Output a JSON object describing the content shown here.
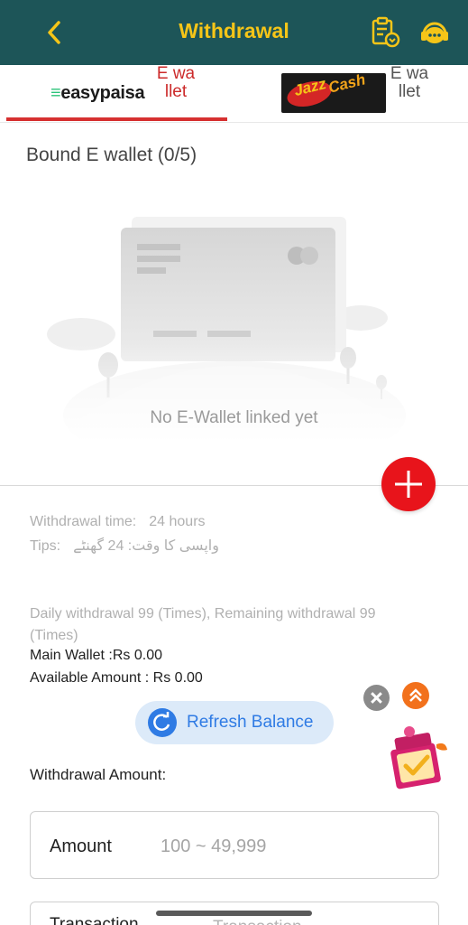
{
  "header": {
    "title": "Withdrawal",
    "back_icon": "chevron-left-icon",
    "history_icon": "clipboard-download-icon",
    "service_icon": "headset-icon",
    "bg_color": "#1d5558",
    "title_color": "#f5c518"
  },
  "tabs": [
    {
      "logo_text": "easypaisa",
      "label": "E wallet",
      "active": true
    },
    {
      "logo_text": "Jazz Cash",
      "logo_j": "Jazz",
      "logo_c": "Cash",
      "label": "E wallet",
      "active": false
    }
  ],
  "bound_title": "Bound E wallet (0/5)",
  "empty_state": {
    "text": "No E-Wallet linked yet"
  },
  "add_button": {
    "icon": "plus-icon",
    "color": "#e8141b"
  },
  "info": {
    "withdrawal_time_label": "Withdrawal time:",
    "withdrawal_time_value": "24 hours",
    "tips_label": "Tips:",
    "tips_value": "واپسی کا وقت: 24 گھنٹے",
    "daily": "Daily withdrawal 99 (Times), Remaining withdrawal 99 (Times)",
    "main_wallet": "Main Wallet :Rs 0.00",
    "available_amount": "Available Amount : Rs 0.00"
  },
  "refresh": {
    "label": "Refresh Balance",
    "icon": "refresh-icon"
  },
  "floating": {
    "close_icon": "close-icon",
    "up_icon": "double-chevron-up-icon",
    "promo_icon": "gift-box-icon"
  },
  "form": {
    "withdrawal_amount_label": "Withdrawal Amount:",
    "amount_label": "Amount",
    "amount_placeholder": "100 ~ 49,999",
    "transaction_label": "Transaction",
    "transaction_placeholder": "Transaction"
  }
}
